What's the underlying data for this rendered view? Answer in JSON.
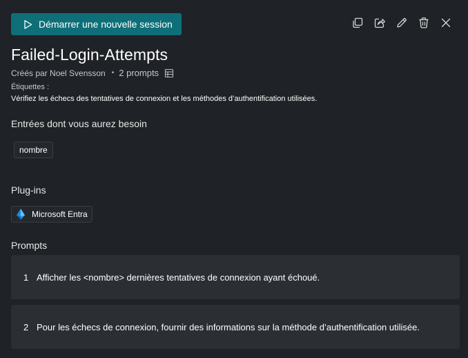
{
  "header": {
    "start_session_label": "Démarrer une nouvelle session"
  },
  "title": "Failed-Login-Attempts",
  "meta": {
    "created_by": "Créés par Noel Svensson",
    "separator": "•",
    "prompt_count": "2 prompts"
  },
  "tags_label": "Étiquettes :",
  "description": "Vérifiez les échecs des tentatives de connexion et les méthodes d’authentification utilisées.",
  "inputs": {
    "heading": "Entrées dont vous aurez besoin",
    "items": [
      "nombre"
    ]
  },
  "plugins": {
    "heading": "Plug-ins",
    "items": [
      {
        "label": "Microsoft Entra",
        "icon": "microsoft-entra-icon"
      }
    ]
  },
  "prompts": {
    "heading": "Prompts",
    "items": [
      {
        "number": "1",
        "text": "Afficher les <nombre> dernières tentatives de connexion ayant échoué."
      },
      {
        "number": "2",
        "text": "Pour les échecs de connexion, fournir des informations sur la méthode d’authentification utilisée."
      }
    ]
  },
  "icons": {
    "start": "play-icon",
    "duplicate": "duplicate-icon",
    "share": "share-icon",
    "edit": "pencil-icon",
    "delete": "trash-icon",
    "close": "close-icon",
    "prompts_table": "table-icon"
  },
  "colors": {
    "background": "#1f2226",
    "accent_button": "#0e6f78",
    "card": "#2b2f34",
    "text": "#ffffff"
  }
}
